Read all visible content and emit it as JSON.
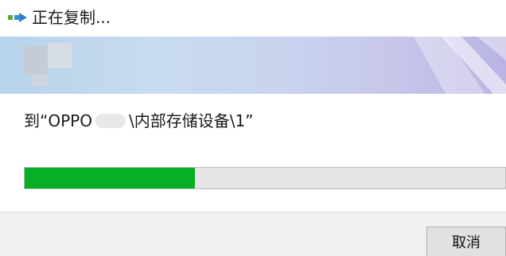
{
  "window": {
    "title": "正在复制..."
  },
  "destination": {
    "prefix": "到“OPPO",
    "suffix": "\\内部存储设备\\1”"
  },
  "progress": {
    "fraction": 0.355,
    "color": "#06b025"
  },
  "buttons": {
    "cancel_label": "取消"
  },
  "icons": {
    "title_icon": "copy-arrow-icon"
  }
}
